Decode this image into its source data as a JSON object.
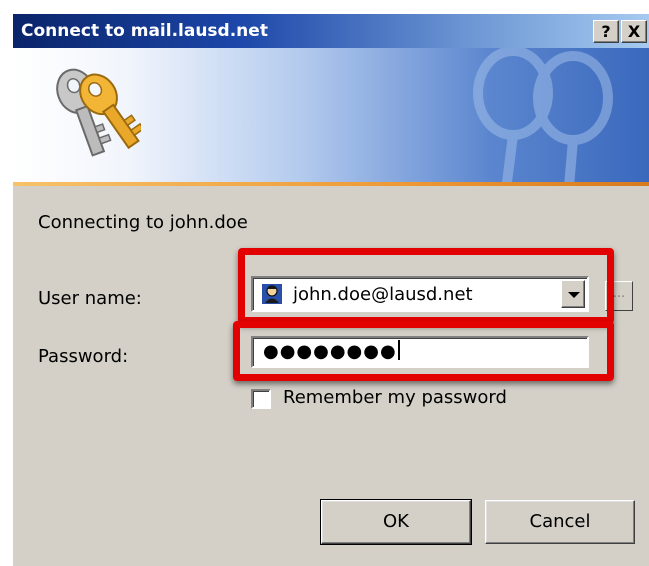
{
  "window": {
    "title": "Connect to mail.lausd.net",
    "help_label": "?",
    "close_label": "X"
  },
  "main": {
    "connecting_text": "Connecting to john.doe",
    "user_label": "User name:",
    "password_label": "Password:",
    "user_value": "john.doe@lausd.net",
    "password_masked": "●●●●●●●●",
    "browse_label": "...",
    "remember_label": "Remember my password",
    "remember_checked": false
  },
  "buttons": {
    "ok_label": "OK",
    "cancel_label": "Cancel"
  },
  "icons": {
    "banner": "keys-icon",
    "user": "user-account-icon",
    "dropdown": "chevron-down-icon"
  },
  "colors": {
    "titlebar": "#0a246a",
    "highlight": "#e30000",
    "dialog_bg": "#d4d0c8"
  }
}
